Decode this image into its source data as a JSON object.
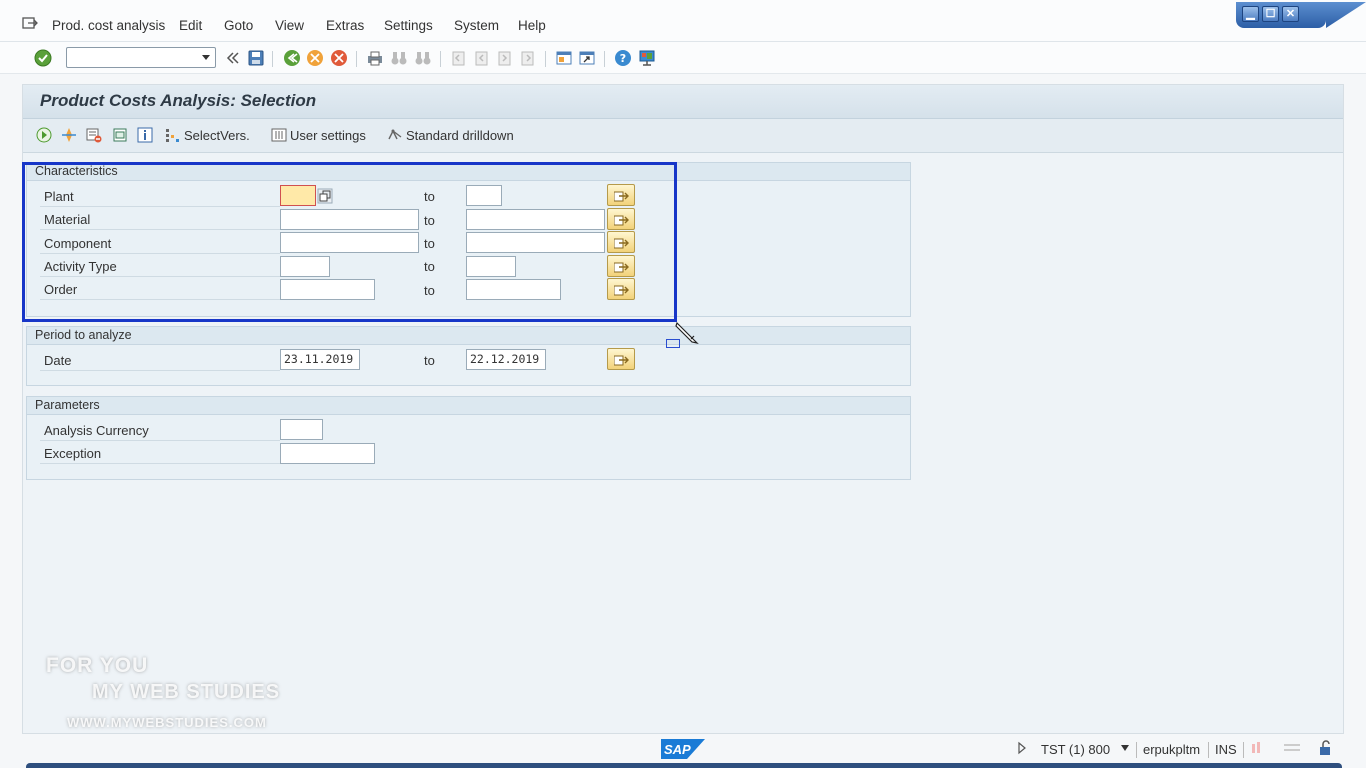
{
  "menu": {
    "items": [
      "Prod. cost analysis",
      "Edit",
      "Goto",
      "View",
      "Extras",
      "Settings",
      "System",
      "Help"
    ]
  },
  "window_controls": {
    "minimize": "▁",
    "maximize": "☐",
    "close": "✕"
  },
  "toolbar": {
    "command_field_value": ""
  },
  "screen": {
    "title": "Product Costs Analysis: Selection",
    "app_toolbar": {
      "select_versions": "SelectVers.",
      "user_settings": "User settings",
      "standard_drilldown": "Standard drilldown"
    }
  },
  "characteristics": {
    "title": "Characteristics",
    "rows": [
      {
        "label": "Plant",
        "from": "",
        "to_label": "to",
        "to": ""
      },
      {
        "label": "Material",
        "from": "",
        "to_label": "to",
        "to": ""
      },
      {
        "label": "Component",
        "from": "",
        "to_label": "to",
        "to": ""
      },
      {
        "label": "Activity Type",
        "from": "",
        "to_label": "to",
        "to": ""
      },
      {
        "label": "Order",
        "from": "",
        "to_label": "to",
        "to": ""
      }
    ]
  },
  "period": {
    "title": "Period to analyze",
    "date_label": "Date",
    "from": "23.11.2019",
    "to_label": "to",
    "to": "22.12.2019"
  },
  "parameters": {
    "title": "Parameters",
    "currency_label": "Analysis Currency",
    "currency_value": "",
    "exception_label": "Exception",
    "exception_value": ""
  },
  "watermark": {
    "line1": "FOR YOU",
    "line2": "MY WEB STUDIES",
    "line3": "WWW.MYWEBSTUDIES.COM"
  },
  "statusbar": {
    "logo": "SAP",
    "system": "TST (1) 800",
    "server": "erpukpltm",
    "mode": "INS"
  },
  "colors": {
    "highlight": "#1736c8",
    "title_bar": "#dbe6ee",
    "active_field": "#ffe9a8"
  }
}
